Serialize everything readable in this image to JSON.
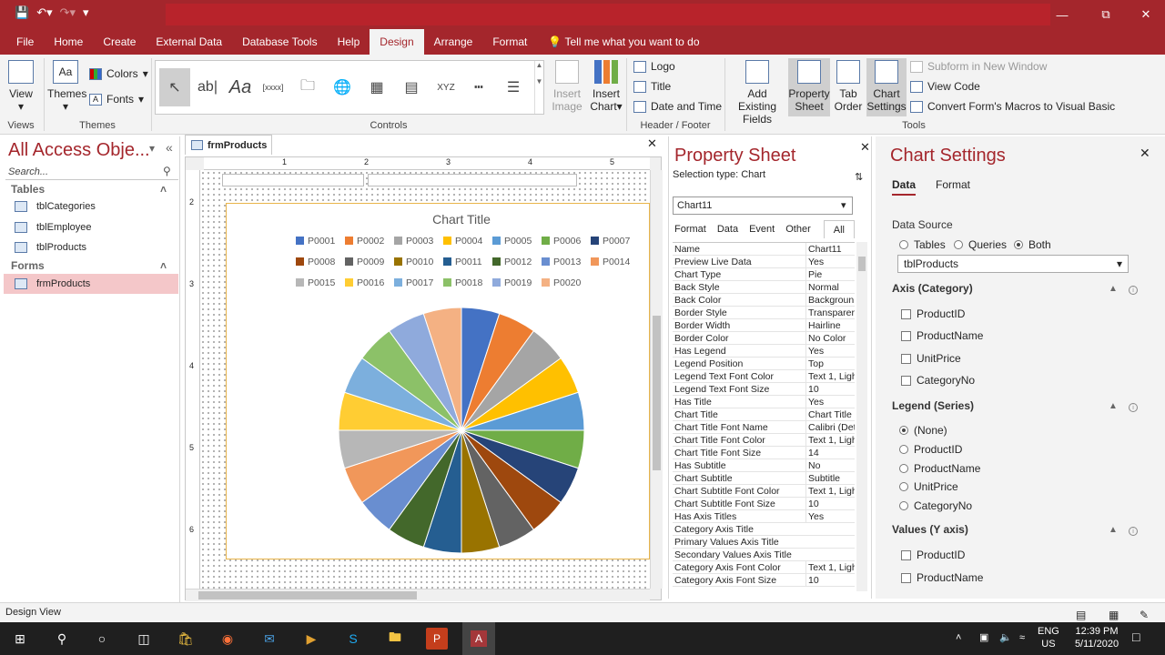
{
  "ribbon": {
    "tabs": [
      "File",
      "Home",
      "Create",
      "External Data",
      "Database Tools",
      "Help",
      "Design",
      "Arrange",
      "Format"
    ],
    "active_tab": "Design",
    "tell_me": "Tell me what you want to do",
    "views": {
      "view": "View",
      "label": "Views"
    },
    "themes": {
      "themes": "Themes",
      "colors": "Colors",
      "fonts": "Fonts",
      "label": "Themes"
    },
    "controls_label": "Controls",
    "insert_image": "Insert\nImage",
    "insert_chart": "Insert\nChart",
    "header_footer": {
      "logo": "Logo",
      "title": "Title",
      "date_time": "Date and Time",
      "label": "Header / Footer"
    },
    "tools": {
      "add_existing": "Add Existing\nFields",
      "property_sheet": "Property\nSheet",
      "tab_order": "Tab\nOrder",
      "chart_settings": "Chart\nSettings",
      "subform": "Subform in New Window",
      "view_code": "View Code",
      "convert_macros": "Convert Form's Macros to Visual Basic",
      "label": "Tools"
    }
  },
  "nav": {
    "title": "All Access Obje...",
    "search_placeholder": "Search...",
    "sections": [
      {
        "name": "Tables",
        "items": [
          "tblCategories",
          "tblEmployee",
          "tblProducts"
        ]
      },
      {
        "name": "Forms",
        "items": [
          "frmProducts"
        ]
      }
    ]
  },
  "document": {
    "tab": "frmProducts",
    "ruler_top": [
      "1",
      "2",
      "3",
      "4",
      "5"
    ],
    "ruler_left": [
      "2",
      "3",
      "4",
      "5",
      "6"
    ]
  },
  "chart_data": {
    "type": "pie",
    "title": "Chart Title",
    "legend_position": "top",
    "categories": [
      "P0001",
      "P0002",
      "P0003",
      "P0004",
      "P0005",
      "P0006",
      "P0007",
      "P0008",
      "P0009",
      "P0010",
      "P0011",
      "P0012",
      "P0013",
      "P0014",
      "P0015",
      "P0016",
      "P0017",
      "P0018",
      "P0019",
      "P0020"
    ],
    "values": [
      1,
      1,
      1,
      1,
      1,
      1,
      1,
      1,
      1,
      1,
      1,
      1,
      1,
      1,
      1,
      1,
      1,
      1,
      1,
      1
    ],
    "colors": [
      "#4472c4",
      "#ed7d31",
      "#a5a5a5",
      "#ffc000",
      "#5b9bd5",
      "#70ad47",
      "#264478",
      "#9e480e",
      "#636363",
      "#997300",
      "#255e91",
      "#43682b",
      "#698ed0",
      "#f1975a",
      "#b7b7b7",
      "#ffcd33",
      "#7cafdd",
      "#8cc168",
      "#8faadc",
      "#f4b183"
    ]
  },
  "property_sheet": {
    "title": "Property Sheet",
    "selection_type": "Selection type:  Chart",
    "object": "Chart11",
    "tabs": [
      "Format",
      "Data",
      "Event",
      "Other",
      "All"
    ],
    "active_tab": "All",
    "rows": [
      [
        "Name",
        "Chart11"
      ],
      [
        "Preview Live Data",
        "Yes"
      ],
      [
        "Chart Type",
        "Pie"
      ],
      [
        "Back Style",
        "Normal"
      ],
      [
        "Back Color",
        "Backgroun"
      ],
      [
        "Border Style",
        "Transparer"
      ],
      [
        "Border Width",
        "Hairline"
      ],
      [
        "Border Color",
        "No Color"
      ],
      [
        "Has Legend",
        "Yes"
      ],
      [
        "Legend Position",
        "Top"
      ],
      [
        "Legend Text Font Color",
        "Text 1, Ligh"
      ],
      [
        "Legend Text Font Size",
        "10"
      ],
      [
        "Has Title",
        "Yes"
      ],
      [
        "Chart Title",
        "Chart Title"
      ],
      [
        "Chart Title Font Name",
        "Calibri (Det"
      ],
      [
        "Chart Title Font Color",
        "Text 1, Ligh"
      ],
      [
        "Chart Title Font Size",
        "14"
      ],
      [
        "Has Subtitle",
        "No"
      ],
      [
        "Chart Subtitle",
        "Subtitle"
      ],
      [
        "Chart Subtitle Font Color",
        "Text 1, Ligh"
      ],
      [
        "Chart Subtitle Font Size",
        "10"
      ],
      [
        "Has Axis Titles",
        "Yes"
      ],
      [
        "Category Axis Title",
        ""
      ],
      [
        "Primary Values Axis Title",
        ""
      ],
      [
        "Secondary Values Axis Title",
        ""
      ],
      [
        "Category Axis Font Color",
        "Text 1, Ligh"
      ],
      [
        "Category Axis Font Size",
        "10"
      ]
    ]
  },
  "chart_settings": {
    "title": "Chart Settings",
    "tabs": [
      "Data",
      "Format"
    ],
    "data_source_label": "Data Source",
    "source_options": [
      "Tables",
      "Queries",
      "Both"
    ],
    "source_selected": "Both",
    "source_value": "tblProducts",
    "axis_label": "Axis (Category)",
    "axis_fields": [
      "ProductID",
      "ProductName",
      "UnitPrice",
      "CategoryNo"
    ],
    "legend_label": "Legend (Series)",
    "legend_fields": [
      "(None)",
      "ProductID",
      "ProductName",
      "UnitPrice",
      "CategoryNo"
    ],
    "legend_selected": "(None)",
    "values_label": "Values (Y axis)",
    "values_fields": [
      "ProductID",
      "ProductName"
    ]
  },
  "status": {
    "text": "Design View"
  },
  "taskbar": {
    "lang": "ENG",
    "region": "US",
    "time": "12:39 PM",
    "date": "5/11/2020"
  }
}
